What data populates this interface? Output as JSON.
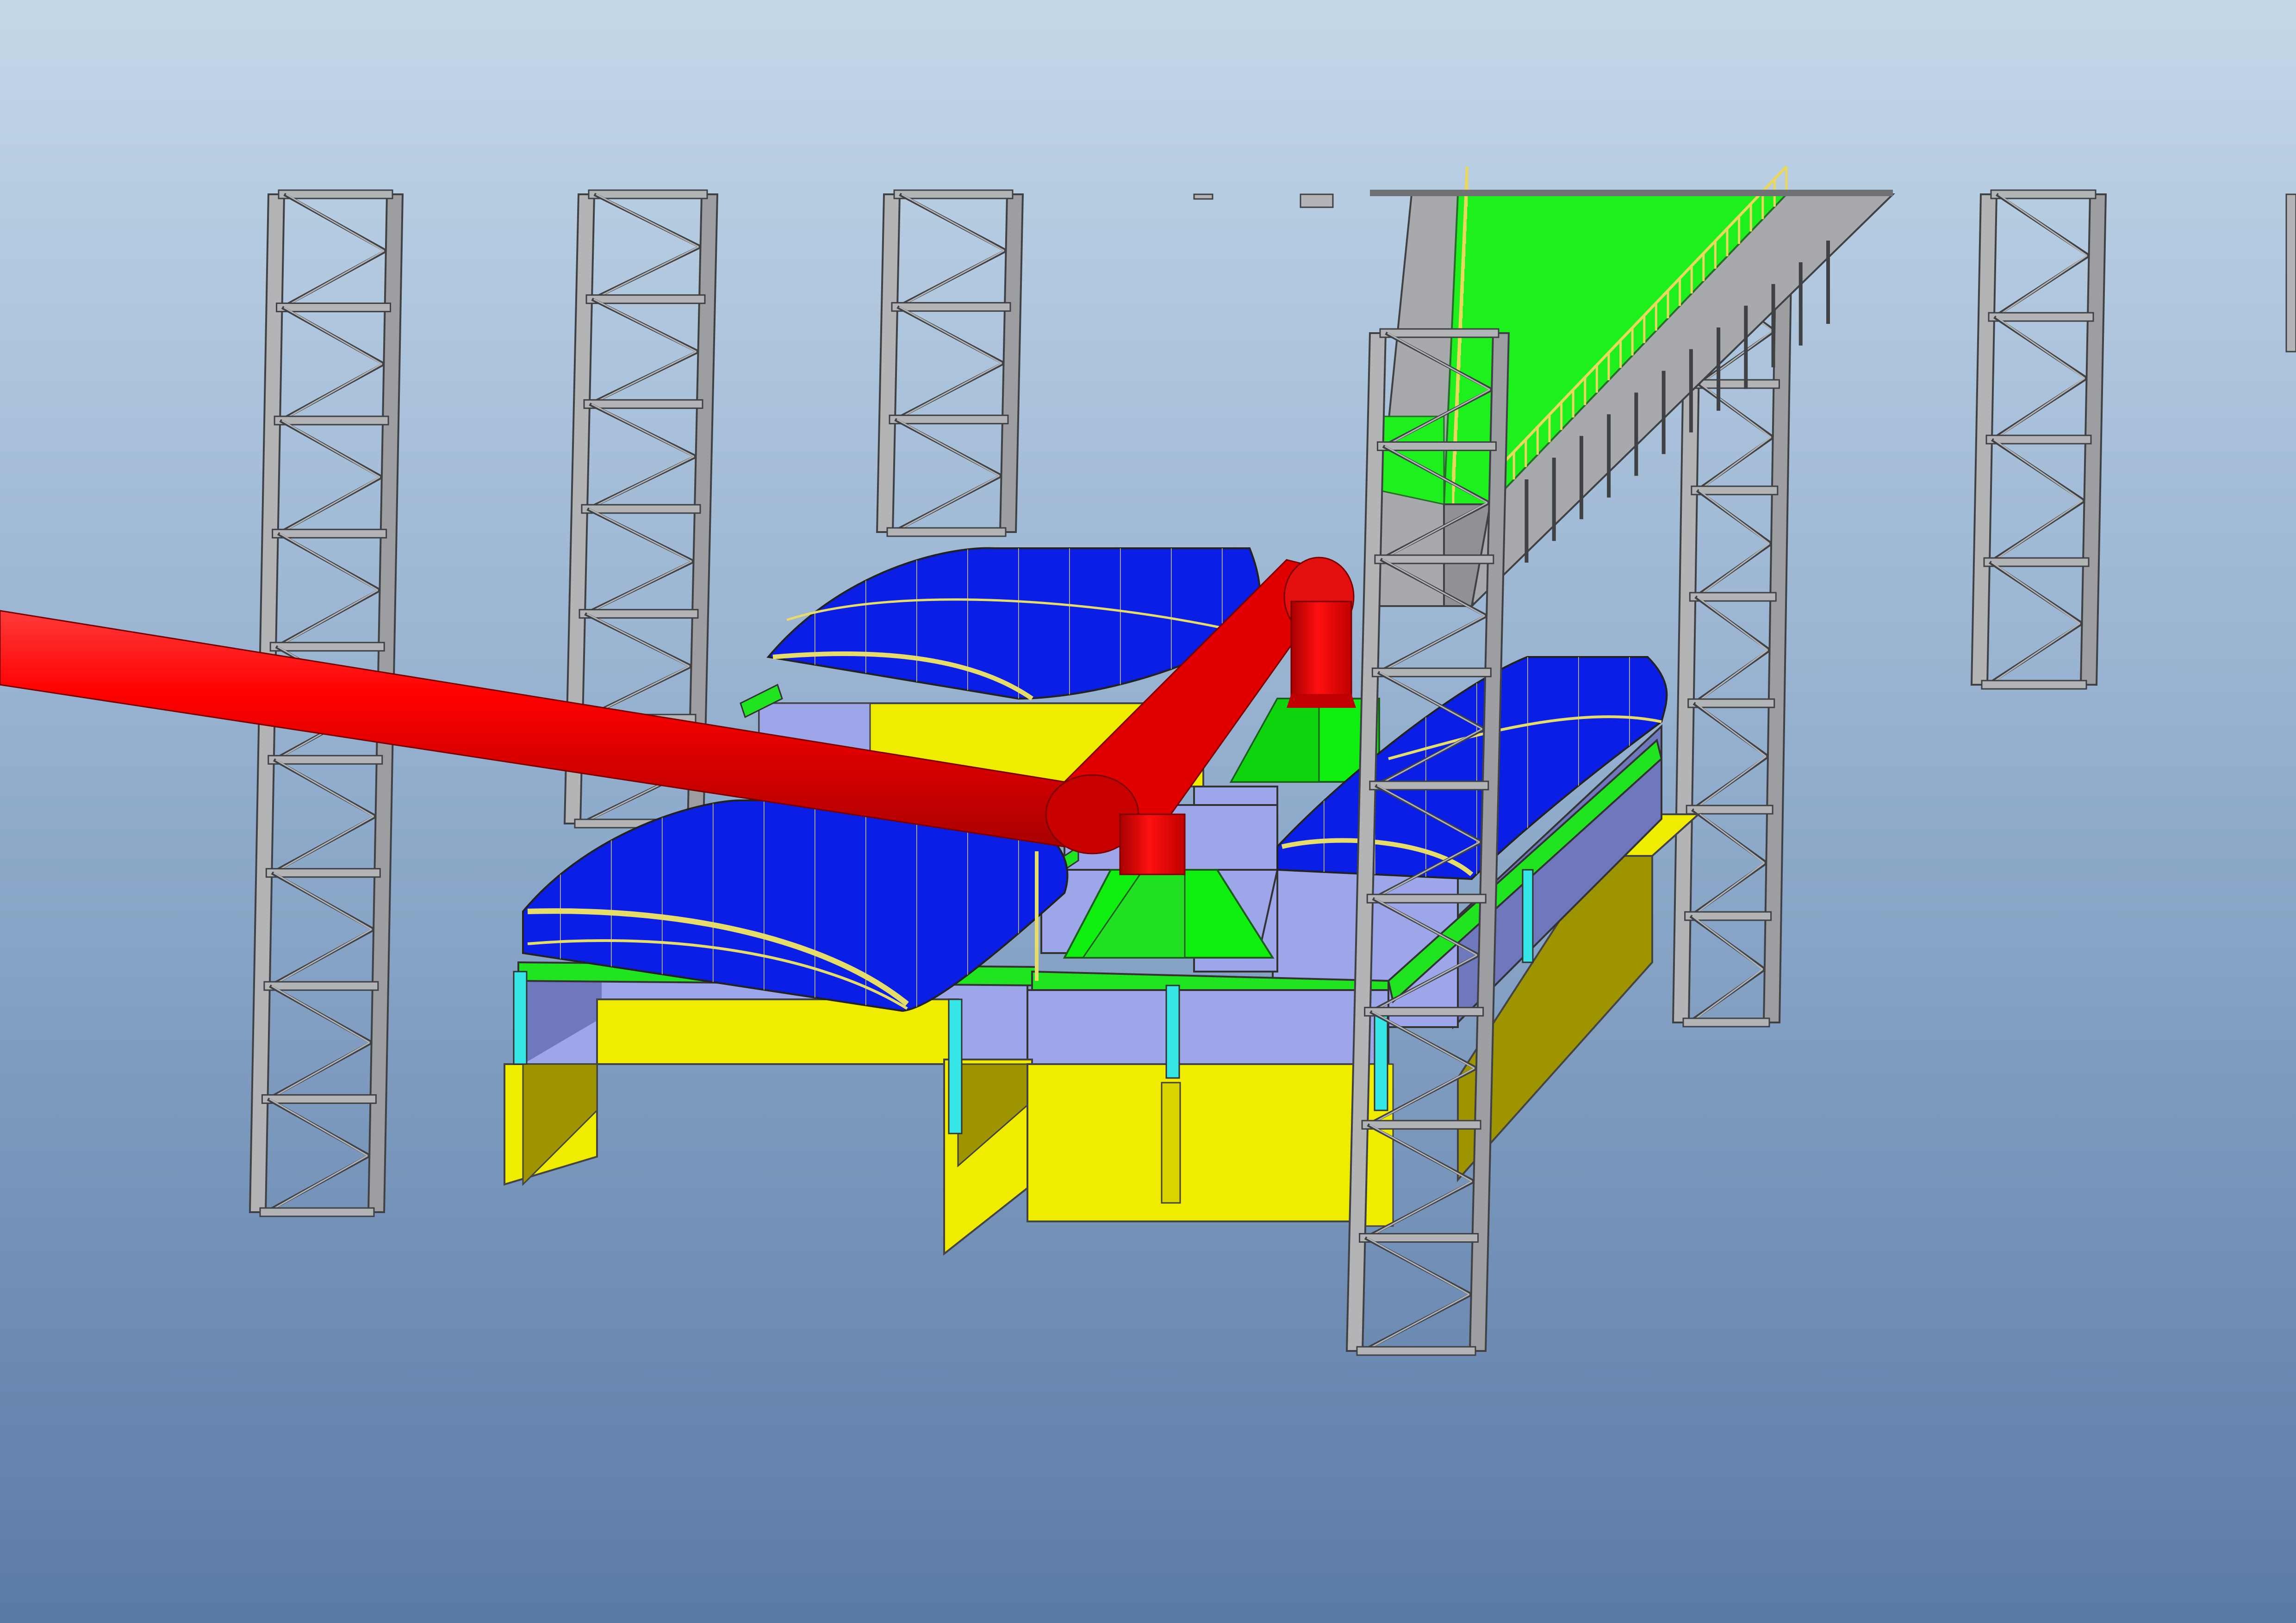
{
  "view": {
    "kind": "3D model viewport",
    "background_gradient": [
      "#c3d7e8",
      "#95b0cf",
      "#5a7aa6"
    ]
  },
  "colors": {
    "steel": "#b3b4b6",
    "steel_edge": "#3f4145",
    "steel_dark": "#9c9ea2",
    "roof": "#0a1ee6",
    "roof_truss": "#e6dc6a",
    "pipe": "#f00000",
    "pipe_shade": "#c00000",
    "hopper": "#10f010",
    "platform": "#1ef01e",
    "beam": "#1fe41f",
    "wall_lilac": "#9ea6ea",
    "wall_shade": "#6f77bd",
    "concrete_yellow": "#f0ec00",
    "concrete_shade": "#9d9400",
    "column_cyan": "#36e6e6",
    "railing": "#e8d860"
  },
  "objects": [
    {
      "name": "tower-1",
      "type": "lattice steel tower"
    },
    {
      "name": "tower-2",
      "type": "lattice steel tower"
    },
    {
      "name": "tower-3",
      "type": "lattice steel tower"
    },
    {
      "name": "tower-4",
      "type": "lattice steel tower"
    },
    {
      "name": "tower-5",
      "type": "lattice steel tower"
    },
    {
      "name": "tower-6",
      "type": "lattice steel tower"
    },
    {
      "name": "conveyor-gallery",
      "type": "truss bridge with green walkway"
    },
    {
      "name": "red-duct",
      "type": "pipe"
    },
    {
      "name": "roof-left-back",
      "type": "arched roof"
    },
    {
      "name": "roof-left-front",
      "type": "arched roof"
    },
    {
      "name": "roof-right",
      "type": "arched roof"
    },
    {
      "name": "hopper-back",
      "type": "hopper"
    },
    {
      "name": "hopper-front",
      "type": "hopper"
    },
    {
      "name": "basin-structure",
      "type": "concrete basin"
    }
  ]
}
